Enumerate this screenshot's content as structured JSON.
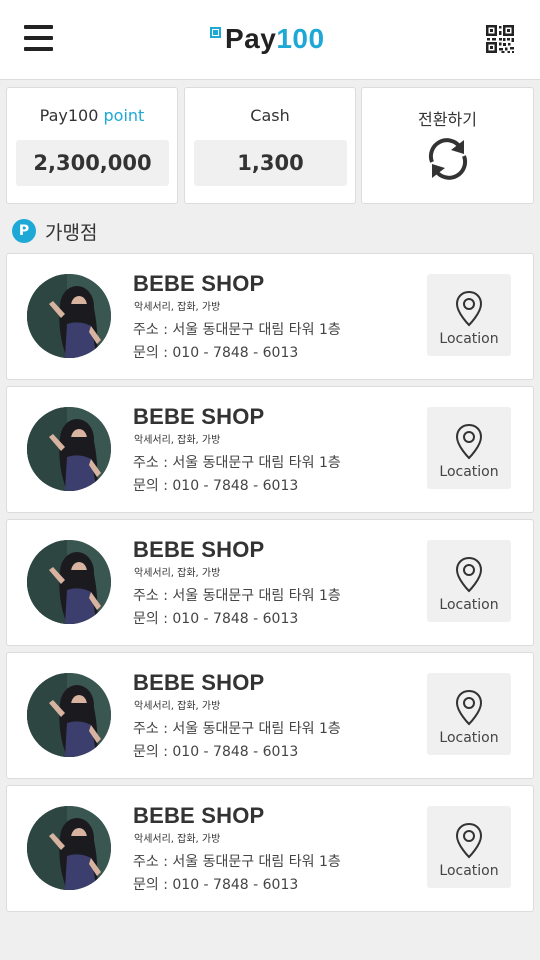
{
  "header": {
    "logo_text": "Pay",
    "logo_number": "100",
    "brand_color": "#1ea8d6",
    "menu_icon": "hamburger-menu-icon",
    "qr_icon": "qr-code-icon"
  },
  "balances": {
    "point_label_prefix": "Pay100",
    "point_label_accent": "point",
    "point_value": "2,300,000",
    "cash_label": "Cash",
    "cash_value": "1,300",
    "convert_label": "전환하기",
    "convert_icon": "refresh-arrows-icon"
  },
  "section": {
    "badge": "P",
    "title": "가맹점"
  },
  "shops": [
    {
      "name": "BEBE SHOP",
      "category": "악세서리, 잡화, 가방",
      "address": "주소 : 서울 동대문구 대림 타워 1층",
      "phone": "문의 : 010 - 7848 - 6013",
      "location_label": "Location"
    },
    {
      "name": "BEBE SHOP",
      "category": "악세서리, 잡화, 가방",
      "address": "주소 : 서울 동대문구 대림 타워 1층",
      "phone": "문의 : 010 - 7848 - 6013",
      "location_label": "Location"
    },
    {
      "name": "BEBE SHOP",
      "category": "악세서리, 잡화, 가방",
      "address": "주소 : 서울 동대문구 대림 타워 1층",
      "phone": "문의 : 010 - 7848 - 6013",
      "location_label": "Location"
    },
    {
      "name": "BEBE SHOP",
      "category": "악세서리, 잡화, 가방",
      "address": "주소 : 서울 동대문구 대림 타워 1층",
      "phone": "문의 : 010 - 7848 - 6013",
      "location_label": "Location"
    },
    {
      "name": "BEBE SHOP",
      "category": "악세서리, 잡화, 가방",
      "address": "주소 : 서울 동대문구 대림 타워 1층",
      "phone": "문의 : 010 - 7848 - 6013",
      "location_label": "Location"
    }
  ]
}
